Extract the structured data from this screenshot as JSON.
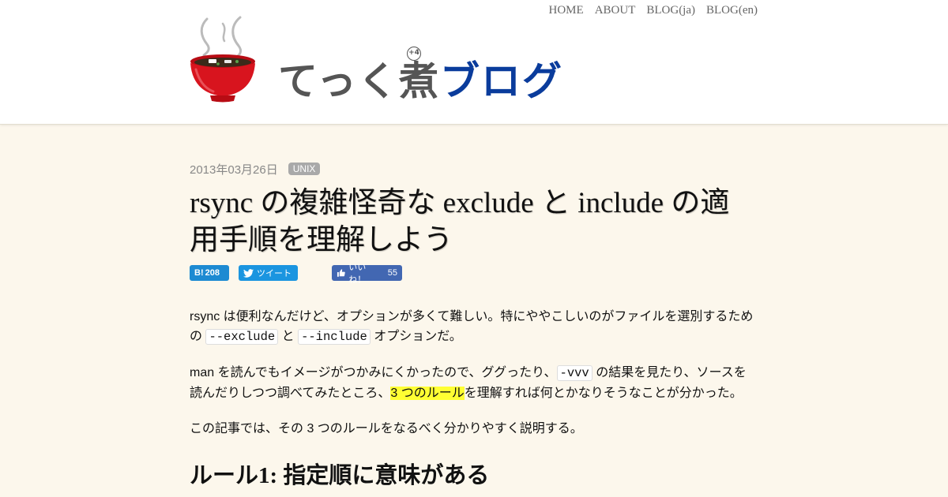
{
  "nav": {
    "items": [
      "HOME",
      "ABOUT",
      "BLOG(ja)",
      "BLOG(en)"
    ]
  },
  "logo": {
    "text_main": "てっく煮",
    "text_sup": "+4",
    "text_blog": "ブログ"
  },
  "article": {
    "date": "2013年03月26日",
    "tag": "UNIX",
    "title": "rsync の複雑怪奇な exclude と include の適用手順を理解しよう",
    "share": {
      "hatena_count": "208",
      "tweet_label": "ツイート",
      "like_label": "いいね！",
      "like_count": "55"
    },
    "p1": {
      "text1": "rsync は便利なんだけど、オプションが多くて難しい。特にややこしいのがファイルを選別するための ",
      "code1": "--exclude",
      "text2": " と ",
      "code2": "--include",
      "text3": " オプションだ。"
    },
    "p2": {
      "text1": "man を読んでもイメージがつかみにくかったので、ググったり、",
      "code1": "-vvv",
      "text2": " の結果を見たり、ソースを読んだりしつつ調べてみたところ、",
      "highlight": "3 つのルール",
      "text3": "を理解すれば何とかなりそうなことが分かった。"
    },
    "p3": "この記事では、その 3 つのルールをなるべく分かりやすく説明する。",
    "section_heading": "ルール1: 指定順に意味がある"
  },
  "colors": {
    "background": "#fcf7ec",
    "header_bg": "#ffffff",
    "logo_blue": "#0a3c9c",
    "bowl_red": "#d8141e",
    "highlight": "#ffff33",
    "hatena_blue": "#1d8ad2",
    "twitter_blue": "#1b95e0",
    "facebook_blue": "#4267b2"
  }
}
